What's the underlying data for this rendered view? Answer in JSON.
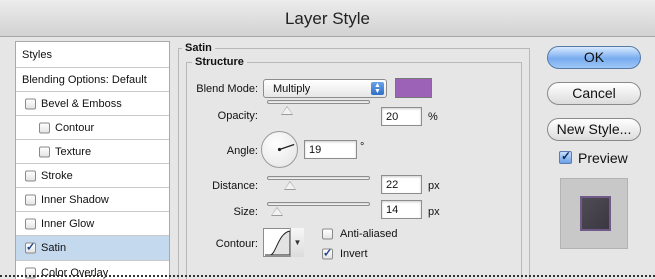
{
  "window": {
    "title": "Layer Style"
  },
  "styles_list": {
    "items": [
      {
        "label": "Styles",
        "checkbox": false,
        "checked": false,
        "selected": false
      },
      {
        "label": "Blending Options: Default",
        "checkbox": false,
        "checked": false,
        "selected": false
      },
      {
        "label": "Bevel & Emboss",
        "checkbox": true,
        "checked": false,
        "selected": false
      },
      {
        "label": "Contour",
        "checkbox": true,
        "checked": false,
        "selected": false
      },
      {
        "label": "Texture",
        "checkbox": true,
        "checked": false,
        "selected": false
      },
      {
        "label": "Stroke",
        "checkbox": true,
        "checked": false,
        "selected": false
      },
      {
        "label": "Inner Shadow",
        "checkbox": true,
        "checked": false,
        "selected": false
      },
      {
        "label": "Inner Glow",
        "checkbox": true,
        "checked": false,
        "selected": false
      },
      {
        "label": "Satin",
        "checkbox": true,
        "checked": true,
        "selected": true
      },
      {
        "label": "Color Overlay",
        "checkbox": true,
        "checked": false,
        "selected": false
      }
    ]
  },
  "satin": {
    "group_title": "Satin",
    "structure_title": "Structure",
    "blend_mode": {
      "label": "Blend Mode:",
      "value": "Multiply",
      "color": "#9b62b8"
    },
    "opacity": {
      "label": "Opacity:",
      "value": "20",
      "unit": "%",
      "percent": 20
    },
    "angle": {
      "label": "Angle:",
      "value": "19",
      "unit": "°",
      "degrees": 19
    },
    "distance": {
      "label": "Distance:",
      "value": "22",
      "unit": "px"
    },
    "size": {
      "label": "Size:",
      "value": "14",
      "unit": "px"
    },
    "contour": {
      "label": "Contour:"
    },
    "anti_aliased": {
      "label": "Anti-aliased",
      "checked": false
    },
    "invert": {
      "label": "Invert",
      "checked": true
    }
  },
  "buttons": {
    "ok": "OK",
    "cancel": "Cancel",
    "new_style": "New Style..."
  },
  "preview": {
    "label": "Preview",
    "checked": true
  },
  "colors": {
    "selected_row": "#c4d9ee",
    "default_button": "#78acef"
  }
}
